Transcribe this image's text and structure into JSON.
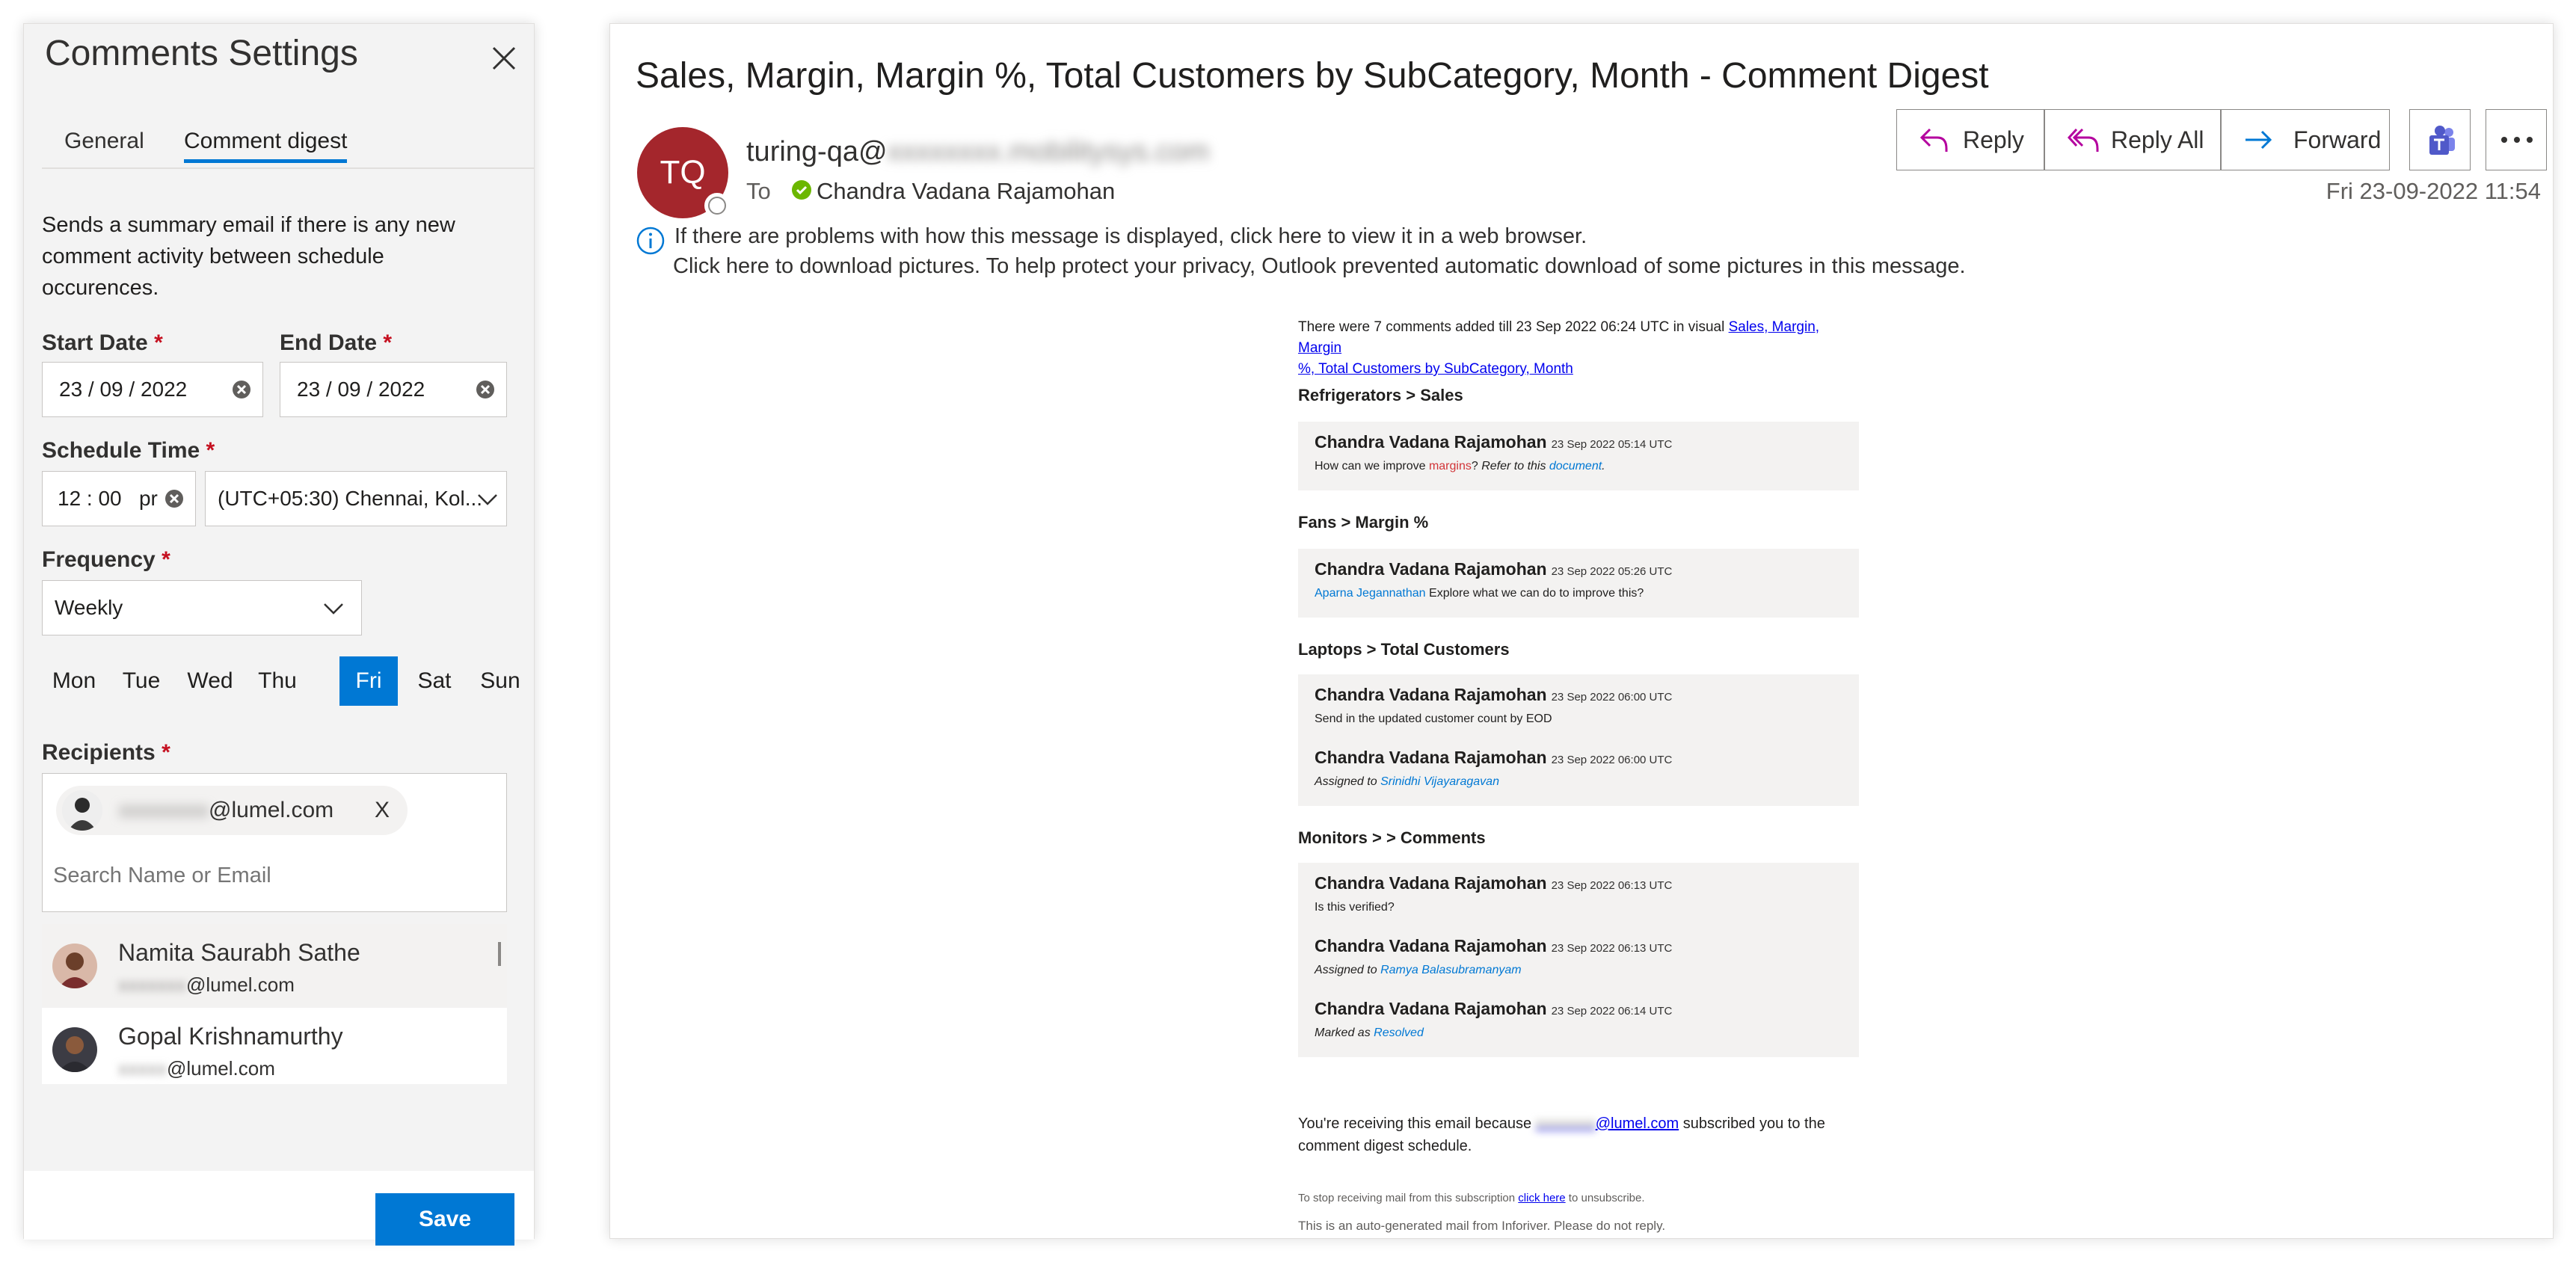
{
  "settings": {
    "title": "Comments Settings",
    "tabs": [
      "General",
      "Comment digest"
    ],
    "description": "Sends a summary email if there is any new comment activity between schedule occurences.",
    "start_label": "Start Date",
    "start_value": "23 / 09 / 2022",
    "end_label": "End Date",
    "end_value": "23 / 09 / 2022",
    "time_label": "Schedule Time",
    "time_value": "12 : 00   pr",
    "timezone_value": "(UTC+05:30) Chennai, Kol...",
    "frequency_label": "Frequency",
    "frequency_value": "Weekly",
    "days": [
      "Mon",
      "Tue",
      "Wed",
      "Thu",
      "Fri",
      "Sat",
      "Sun"
    ],
    "selected_day": "Fri",
    "recipients_label": "Recipients",
    "recipient_chip": {
      "local": "xxxxxxxx",
      "domain": "@lumel.com",
      "remove": "X"
    },
    "search_placeholder": "Search Name or Email",
    "suggestions": [
      {
        "name": "Namita Saurabh Sathe",
        "local": "xxxxxxx",
        "domain": "@lumel.com"
      },
      {
        "name": "Gopal Krishnamurthy",
        "local": "xxxxx",
        "domain": "@lumel.com"
      }
    ],
    "save_label": "Save",
    "required_mark": "*"
  },
  "email": {
    "subject": "Sales, Margin, Margin %, Total Customers by SubCategory, Month - Comment Digest",
    "avatar_initials": "TQ",
    "from_visible": "turing-qa@",
    "from_hidden": "xxxxxxxx.mobilitysys.com",
    "to_label": "To",
    "to_name": "Chandra Vadana Rajamohan",
    "actions": {
      "reply": "Reply",
      "reply_all": "Reply All",
      "forward": "Forward"
    },
    "date": "Fri 23-09-2022 11:54",
    "info_line1": "If there are problems with how this message is displayed, click here to view it in a web browser.",
    "info_line2": "Click here to download pictures. To help protect your privacy, Outlook prevented automatic download of some pictures in this message."
  },
  "digest": {
    "intro_text": "There were 7 comments added till 23 Sep 2022 06:24 UTC in visual ",
    "intro_link_1": "Sales, Margin, Margin",
    "intro_link_2": "%, Total Customers by SubCategory, Month",
    "sections": [
      {
        "heading": "Refrigerators > Sales",
        "comments": [
          {
            "author": "Chandra Vadana Rajamohan",
            "time": "23 Sep 2022 05:14 UTC",
            "p1": "How can we improve ",
            "p2": "margins",
            "p3": "? ",
            "p4": "Refer to this ",
            "p5": "document",
            "p6": "."
          }
        ]
      },
      {
        "heading": "Fans > Margin %",
        "comments": [
          {
            "author": "Chandra Vadana Rajamohan",
            "time": "23 Sep 2022 05:26 UTC",
            "mention": "Aparna Jegannathan",
            "text": " Explore what we can do to improve this?"
          }
        ]
      },
      {
        "heading": "Laptops > Total Customers",
        "comments": [
          {
            "author": "Chandra Vadana Rajamohan",
            "time": "23 Sep 2022 06:00 UTC",
            "text": "Send in the updated customer count by EOD"
          },
          {
            "author": "Chandra Vadana Rajamohan",
            "time": "23 Sep 2022 06:00 UTC",
            "prefix": "Assigned to ",
            "mention": "Srinidhi Vijayaragavan"
          }
        ]
      },
      {
        "heading": "Monitors > > Comments",
        "comments": [
          {
            "author": "Chandra Vadana Rajamohan",
            "time": "23 Sep 2022 06:13 UTC",
            "text": "Is this verified?"
          },
          {
            "author": "Chandra Vadana Rajamohan",
            "time": "23 Sep 2022 06:13 UTC",
            "prefix": "Assigned to ",
            "mention": "Ramya Balasubramanyam"
          },
          {
            "author": "Chandra Vadana Rajamohan",
            "time": "23 Sep 2022 06:14 UTC",
            "prefix": "Marked as ",
            "mention": "Resolved"
          }
        ]
      }
    ],
    "receiving_1": "You're receiving this email because ",
    "receiving_hidden": "xxxxxxxx",
    "receiving_link": "@lumel.com",
    "receiving_2": " subscribed you to the comment digest schedule.",
    "stop_1": "To stop receiving mail from this subscription ",
    "stop_link": "click here",
    "stop_2": " to unsubscribe.",
    "auto_note": "This is an auto-generated mail from Inforiver. Please do not reply."
  },
  "colors": {
    "accent": "#0078d4",
    "avatar": "#a4262c",
    "required": "#c50f1f",
    "teams": "#5059c9"
  },
  "icons": [
    "close-icon",
    "clear-icon",
    "chevron-down-icon",
    "reply-icon",
    "reply-all-icon",
    "forward-icon",
    "teams-icon",
    "more-icon",
    "info-icon",
    "presence-check-icon"
  ]
}
